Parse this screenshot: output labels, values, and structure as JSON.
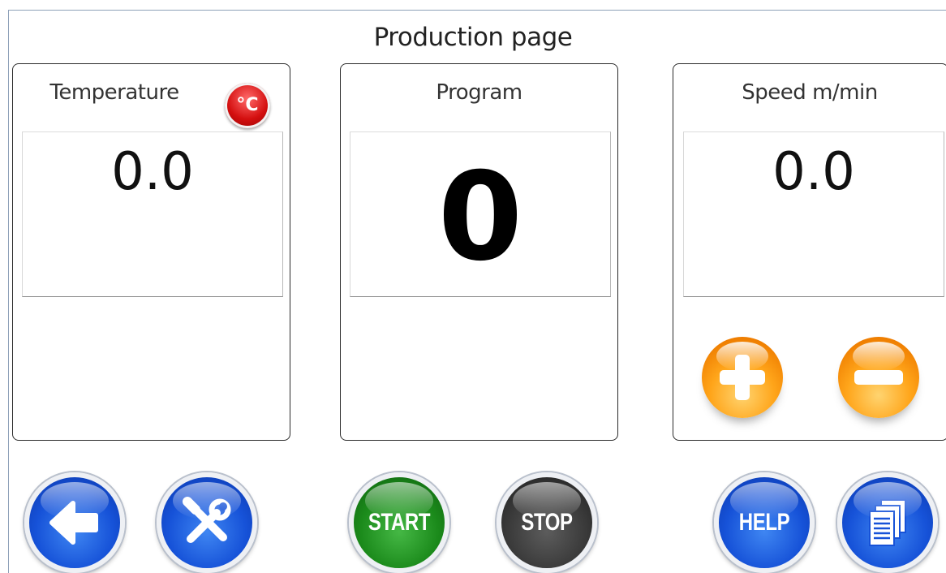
{
  "page": {
    "title": "Production page"
  },
  "panels": {
    "temperature": {
      "title": "Temperature",
      "value": "0.0",
      "unit_icon_text": "°C",
      "unit_icon": "celsius-icon"
    },
    "program": {
      "title": "Program",
      "value": "0"
    },
    "speed": {
      "title": "Speed m/min",
      "value": "0.0"
    }
  },
  "speed_controls": {
    "increase_icon": "plus-icon",
    "decrease_icon": "minus-icon"
  },
  "toolbar": {
    "back_icon": "arrow-left-icon",
    "settings_icon": "tools-icon",
    "start_label": "START",
    "stop_label": "STOP",
    "help_label": "HELP",
    "document_icon": "document-icon"
  },
  "colors": {
    "nav_blue": "#1652d8",
    "start_green": "#1b8a1b",
    "stop_gray": "#3a3a3a",
    "orb_orange": "#ffa51a",
    "celsius_red": "#d40f0f"
  }
}
